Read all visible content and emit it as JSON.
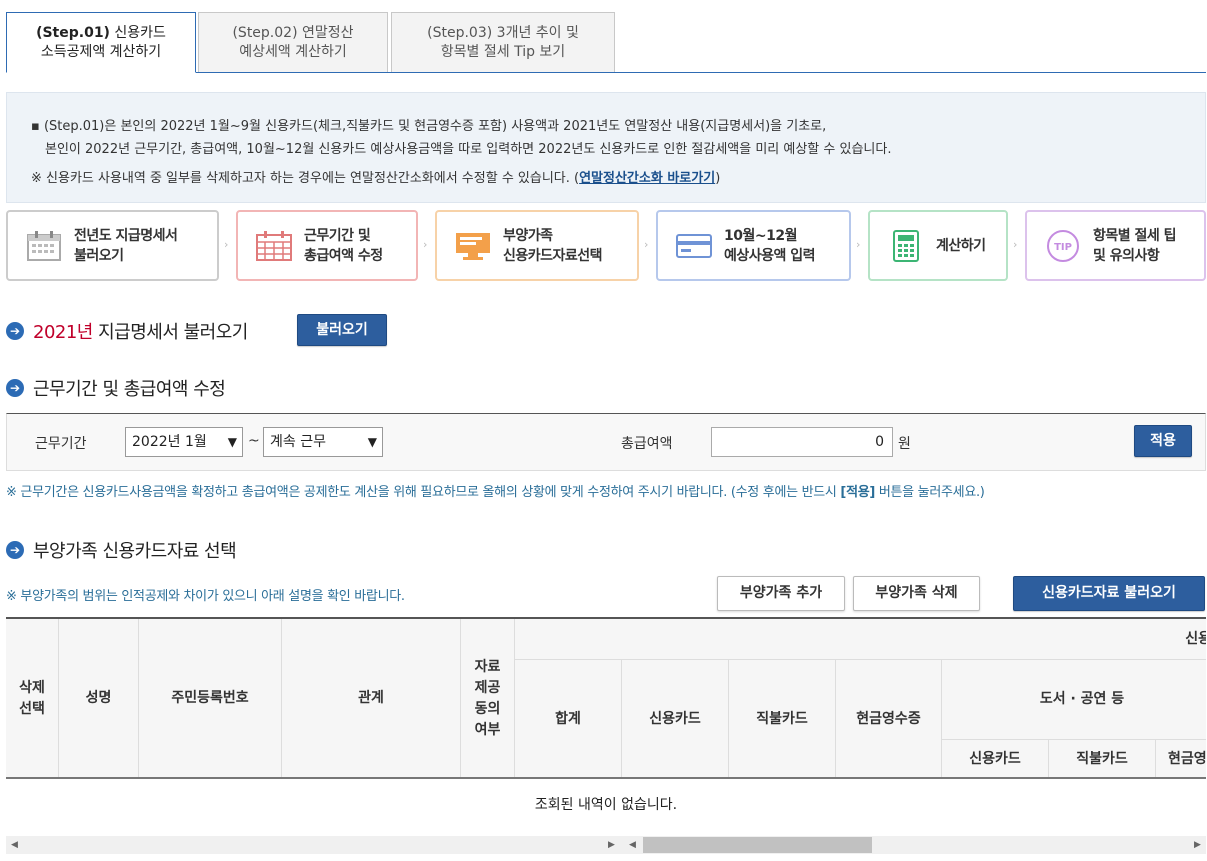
{
  "tabs": [
    {
      "step": "(Step.01)",
      "label1": "신용카드",
      "label2": "소득공제액 계산하기"
    },
    {
      "step": "(Step.02)",
      "label1": "연말정산",
      "label2": "예상세액 계산하기"
    },
    {
      "step": "(Step.03)",
      "label1": "3개년 추이 및",
      "label2": "항목별 절세 Tip 보기"
    }
  ],
  "info": {
    "line1": "▪ (Step.01)은 본인의 2022년 1월~9월 신용카드(체크,직불카드 및 현금영수증 포함) 사용액과 2021년도 연말정산 내용(지급명세서)을 기초로,",
    "line2": "본인이 2022년 근무기간, 총급여액, 10월~12월 신용카드 예상사용금액을 따로 입력하면 2022년도 신용카드로 인한 절감세액을 미리 예상할 수 있습니다.",
    "line3_prefix": "※ 신용카드 사용내역 중 일부를 삭제하고자 하는 경우에는 연말정산간소화에서 수정할 수 있습니다. (",
    "line3_link": "연말정산간소화 바로가기",
    "line3_suffix": ")"
  },
  "process": [
    {
      "l1": "전년도 지급명세서",
      "l2": "불러오기",
      "color": "#cccccc"
    },
    {
      "l1": "근무기간 및",
      "l2": "총급여액 수정",
      "color": "#f2b5b5"
    },
    {
      "l1": "부양가족",
      "l2": "신용카드자료선택",
      "color": "#f7d2a8"
    },
    {
      "l1": "10월~12월",
      "l2": "예상사용액 입력",
      "color": "#b6c8ec"
    },
    {
      "l1": "계산하기",
      "l2": "",
      "color": "#b5e3c6"
    },
    {
      "l1": "항목별 절세 팁",
      "l2": "및 유의사항",
      "color": "#dcc2ec"
    }
  ],
  "sec1": {
    "year": "2021년",
    "title": " 지급명세서 불러오기",
    "button": "불러오기"
  },
  "sec2": {
    "title": "근무기간 및 총급여액 수정"
  },
  "work": {
    "period_label": "근무기간",
    "start": "2022년 1월",
    "tilde": "~",
    "end": "계속 근무",
    "total_label": "총급여액",
    "total_value": "0",
    "unit": "원",
    "apply": "적용"
  },
  "note1_a": "※ 근무기간은 신용카드사용금액을 확정하고 총급여액은 공제한도 계산을 위해 필요하므로 올해의 상황에 맞게 수정하여 주시기 바랍니다. (수정 후에는 반드시 ",
  "note1_b": "[적용]",
  "note1_c": " 버튼을 눌러주세요.)",
  "sec3": {
    "title": "부양가족 신용카드자료 선택"
  },
  "note2": "※ 부양가족의 범위는 인적공제와 차이가 있으니 아래 설명을 확인 바랍니다.",
  "buttons": {
    "add": "부양가족 추가",
    "del": "부양가족 삭제",
    "load": "신용카드자료 불러오기"
  },
  "table": {
    "h_del": "삭제\n선택",
    "h_name": "성명",
    "h_rrn": "주민등록번호",
    "h_rel": "관계",
    "h_agree": "자료\n제공\n동의\n여부",
    "h_top": "신용",
    "h_sum": "합계",
    "h_credit": "신용카드",
    "h_debit": "직불카드",
    "h_cash": "현금영수증",
    "h_book": "도서 · 공연 등",
    "h_b_credit": "신용카드",
    "h_b_debit": "직불카드",
    "h_b_cash": "현금영"
  },
  "empty": "조회된 내역이 없습니다."
}
